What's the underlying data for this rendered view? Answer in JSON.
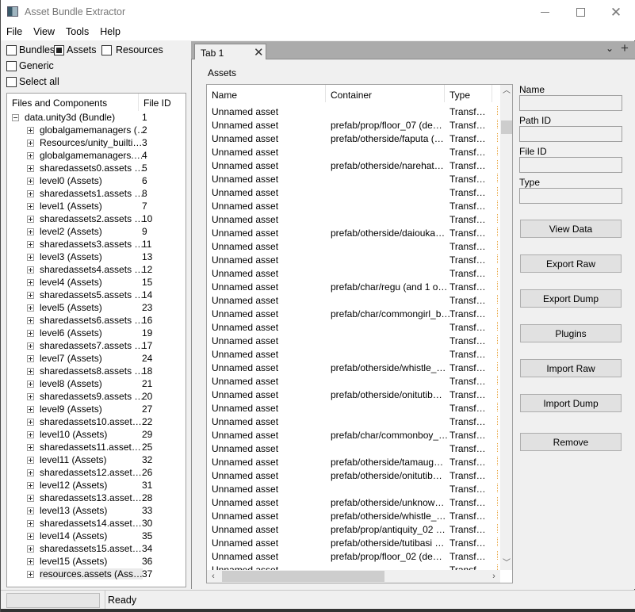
{
  "window": {
    "title": "Asset Bundle Extractor",
    "controls": {
      "minimize": "minimize",
      "maximize": "maximize",
      "close": "close"
    }
  },
  "menu": [
    "File",
    "View",
    "Tools",
    "Help"
  ],
  "filters": {
    "bundles": {
      "label": "Bundles",
      "checked": false
    },
    "assets": {
      "label": "Assets",
      "checked": true
    },
    "resources": {
      "label": "Resources",
      "checked": false
    },
    "generic": {
      "label": "Generic",
      "checked": false
    },
    "select_all": {
      "label": "Select all",
      "checked": false
    }
  },
  "tree": {
    "columns": [
      "Files and Components",
      "File ID"
    ],
    "root": {
      "name": "data.unity3d (Bundle)",
      "id": "1",
      "expanded": true
    },
    "children": [
      {
        "name": "globalgamemanagers (…",
        "id": "2"
      },
      {
        "name": "Resources/unity_builti…",
        "id": "3"
      },
      {
        "name": "globalgamemanagers.…",
        "id": "4"
      },
      {
        "name": "sharedassets0.assets …",
        "id": "5"
      },
      {
        "name": "level0 (Assets)",
        "id": "6"
      },
      {
        "name": "sharedassets1.assets …",
        "id": "8"
      },
      {
        "name": "level1 (Assets)",
        "id": "7"
      },
      {
        "name": "sharedassets2.assets …",
        "id": "10"
      },
      {
        "name": "level2 (Assets)",
        "id": "9"
      },
      {
        "name": "sharedassets3.assets …",
        "id": "11"
      },
      {
        "name": "level3 (Assets)",
        "id": "13"
      },
      {
        "name": "sharedassets4.assets …",
        "id": "12"
      },
      {
        "name": "level4 (Assets)",
        "id": "15"
      },
      {
        "name": "sharedassets5.assets …",
        "id": "14"
      },
      {
        "name": "level5 (Assets)",
        "id": "23"
      },
      {
        "name": "sharedassets6.assets …",
        "id": "16"
      },
      {
        "name": "level6 (Assets)",
        "id": "19"
      },
      {
        "name": "sharedassets7.assets …",
        "id": "17"
      },
      {
        "name": "level7 (Assets)",
        "id": "24"
      },
      {
        "name": "sharedassets8.assets …",
        "id": "18"
      },
      {
        "name": "level8 (Assets)",
        "id": "21"
      },
      {
        "name": "sharedassets9.assets …",
        "id": "20"
      },
      {
        "name": "level9 (Assets)",
        "id": "27"
      },
      {
        "name": "sharedassets10.asset…",
        "id": "22"
      },
      {
        "name": "level10 (Assets)",
        "id": "29"
      },
      {
        "name": "sharedassets11.asset…",
        "id": "25"
      },
      {
        "name": "level11 (Assets)",
        "id": "32"
      },
      {
        "name": "sharedassets12.asset…",
        "id": "26"
      },
      {
        "name": "level12 (Assets)",
        "id": "31"
      },
      {
        "name": "sharedassets13.asset…",
        "id": "28"
      },
      {
        "name": "level13 (Assets)",
        "id": "33"
      },
      {
        "name": "sharedassets14.asset…",
        "id": "30"
      },
      {
        "name": "level14 (Assets)",
        "id": "35"
      },
      {
        "name": "sharedassets15.asset…",
        "id": "34"
      },
      {
        "name": "level15 (Assets)",
        "id": "36"
      },
      {
        "name": "resources.assets (Ass…",
        "id": "37",
        "selected": true
      }
    ]
  },
  "tabs": [
    {
      "label": "Tab 1"
    }
  ],
  "assets": {
    "label": "Assets",
    "columns": [
      "Name",
      "Container",
      "Type",
      ""
    ],
    "rows": [
      {
        "name": "Unnamed asset",
        "container": "",
        "type": "Transf…"
      },
      {
        "name": "Unnamed asset",
        "container": "prefab/prop/floor_07 (de…",
        "type": "Transf…"
      },
      {
        "name": "Unnamed asset",
        "container": "prefab/otherside/faputa (…",
        "type": "Transf…"
      },
      {
        "name": "Unnamed asset",
        "container": "",
        "type": "Transf…"
      },
      {
        "name": "Unnamed asset",
        "container": "prefab/otherside/narehat…",
        "type": "Transf…"
      },
      {
        "name": "Unnamed asset",
        "container": "",
        "type": "Transf…"
      },
      {
        "name": "Unnamed asset",
        "container": "",
        "type": "Transf…"
      },
      {
        "name": "Unnamed asset",
        "container": "",
        "type": "Transf…"
      },
      {
        "name": "Unnamed asset",
        "container": "",
        "type": "Transf…"
      },
      {
        "name": "Unnamed asset",
        "container": "prefab/otherside/daiouka…",
        "type": "Transf…"
      },
      {
        "name": "Unnamed asset",
        "container": "",
        "type": "Transf…"
      },
      {
        "name": "Unnamed asset",
        "container": "",
        "type": "Transf…"
      },
      {
        "name": "Unnamed asset",
        "container": "",
        "type": "Transf…"
      },
      {
        "name": "Unnamed asset",
        "container": "prefab/char/regu (and 1 o…",
        "type": "Transf…"
      },
      {
        "name": "Unnamed asset",
        "container": "",
        "type": "Transf…"
      },
      {
        "name": "Unnamed asset",
        "container": "prefab/char/commongirl_b…",
        "type": "Transf…"
      },
      {
        "name": "Unnamed asset",
        "container": "",
        "type": "Transf…"
      },
      {
        "name": "Unnamed asset",
        "container": "",
        "type": "Transf…"
      },
      {
        "name": "Unnamed asset",
        "container": "",
        "type": "Transf…"
      },
      {
        "name": "Unnamed asset",
        "container": "prefab/otherside/whistle_…",
        "type": "Transf…"
      },
      {
        "name": "Unnamed asset",
        "container": "",
        "type": "Transf…"
      },
      {
        "name": "Unnamed asset",
        "container": "prefab/otherside/onitutib…",
        "type": "Transf…"
      },
      {
        "name": "Unnamed asset",
        "container": "",
        "type": "Transf…"
      },
      {
        "name": "Unnamed asset",
        "container": "",
        "type": "Transf…"
      },
      {
        "name": "Unnamed asset",
        "container": "prefab/char/commonboy_…",
        "type": "Transf…"
      },
      {
        "name": "Unnamed asset",
        "container": "",
        "type": "Transf…"
      },
      {
        "name": "Unnamed asset",
        "container": "prefab/otherside/tamaug…",
        "type": "Transf…"
      },
      {
        "name": "Unnamed asset",
        "container": "prefab/otherside/onitutib…",
        "type": "Transf…"
      },
      {
        "name": "Unnamed asset",
        "container": "",
        "type": "Transf…"
      },
      {
        "name": "Unnamed asset",
        "container": "prefab/otherside/unknow…",
        "type": "Transf…"
      },
      {
        "name": "Unnamed asset",
        "container": "prefab/otherside/whistle_…",
        "type": "Transf…"
      },
      {
        "name": "Unnamed asset",
        "container": "prefab/prop/antiquity_02 …",
        "type": "Transf…"
      },
      {
        "name": "Unnamed asset",
        "container": "prefab/otherside/tutibasi …",
        "type": "Transf…"
      },
      {
        "name": "Unnamed asset",
        "container": "prefab/prop/floor_02 (de…",
        "type": "Transf…"
      },
      {
        "name": "Unnamed asset",
        "container": "",
        "type": "Transf…"
      }
    ]
  },
  "info": {
    "name_label": "Name",
    "name_value": "",
    "path_id_label": "Path ID",
    "path_id_value": "",
    "file_id_label": "File ID",
    "file_id_value": "",
    "type_label": "Type",
    "type_value": ""
  },
  "buttons": {
    "view_data": "View Data",
    "export_raw": "Export Raw",
    "export_dump": "Export Dump",
    "plugins": "Plugins",
    "import_raw": "Import Raw",
    "import_dump": "Import Dump",
    "remove": "Remove"
  },
  "status": {
    "text": "Ready"
  }
}
